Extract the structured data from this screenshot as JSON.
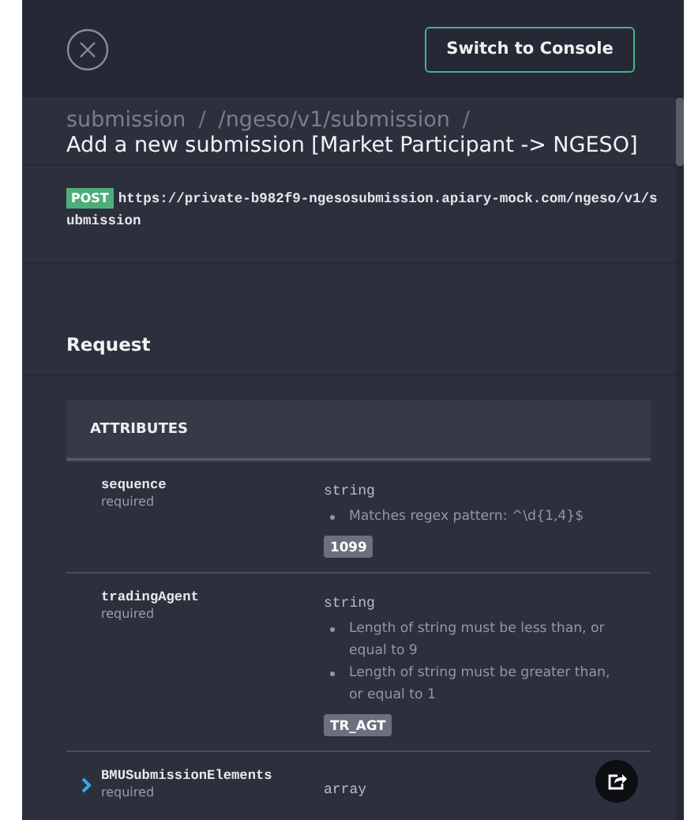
{
  "topbar": {
    "console_button": "Switch to Console"
  },
  "breadcrumbs": [
    {
      "label": "submission",
      "separator": "/"
    },
    {
      "label": "/ngeso/v1/submission",
      "separator": "/"
    }
  ],
  "title": "Add a new submission [Market Participant -> NGESO]",
  "endpoint": {
    "method": "POST",
    "url": "https://private-b982f9-ngesosubmission.apiary-mock.com/ngeso/v1/submission"
  },
  "section_title": "Request",
  "attributes": {
    "heading": "ATTRIBUTES",
    "rows": [
      {
        "kind": "leaf",
        "name": "sequence",
        "required": "required",
        "type": "string",
        "rules": [
          "Matches regex pattern: ^\\d{1,4}$"
        ],
        "example": "1099"
      },
      {
        "kind": "leaf",
        "name": "tradingAgent",
        "required": "required",
        "type": "string",
        "rules": [
          "Length of string must be less than, or equal to 9",
          "Length of string must be greater than, or equal to 1"
        ],
        "example": "TR_AGT"
      },
      {
        "kind": "collapsible",
        "expanded": false,
        "name": "BMUSubmissionElements",
        "required": "required",
        "type": "array"
      }
    ]
  }
}
